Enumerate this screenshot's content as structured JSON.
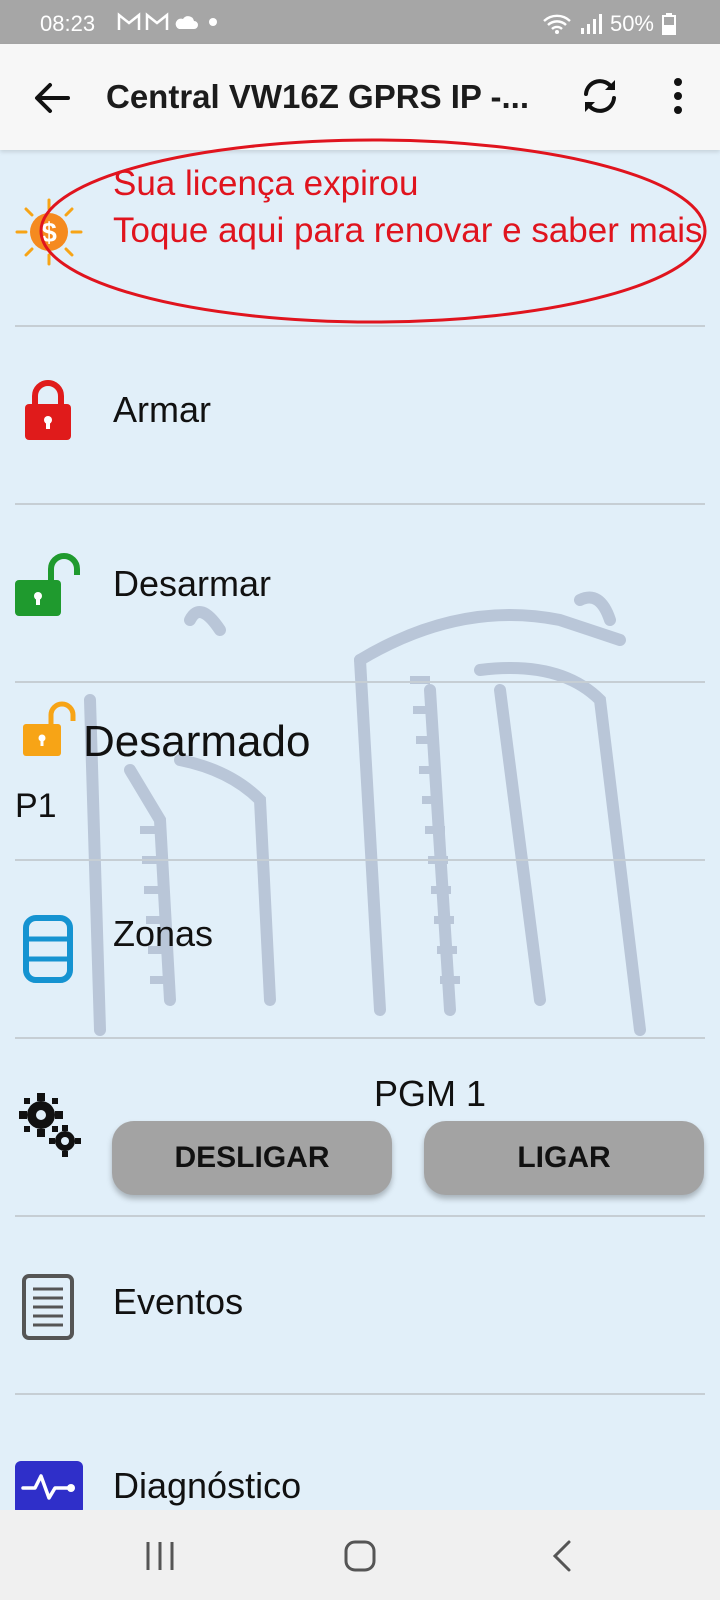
{
  "status_bar": {
    "time": "08:23",
    "battery": "50%"
  },
  "app_bar": {
    "title": "Central VW16Z GPRS IP -..."
  },
  "license": {
    "line1": "Sua licença expirou",
    "line2": "Toque aqui para renovar e saber mais",
    "color": "#e0141e"
  },
  "menu": {
    "armar": "Armar",
    "desarmar": "Desarmar",
    "state": "Desarmado",
    "partition": "P1",
    "zonas": "Zonas",
    "eventos": "Eventos",
    "diagnostico": "Diagnóstico"
  },
  "pgm": {
    "title": "PGM 1",
    "off_label": "DESLIGAR",
    "on_label": "LIGAR"
  },
  "icons": {
    "license": "dollar-sun-icon",
    "armar": "red-lock-icon",
    "desarmar": "green-unlock-icon",
    "state": "orange-unlock-icon",
    "zonas": "zones-cylinder-icon",
    "pgm": "gears-icon",
    "eventos": "document-icon",
    "diagnostico": "pulse-icon"
  },
  "colors": {
    "background": "#e1eff9",
    "lock_red": "#e01b1b",
    "unlock_green": "#1f9a2e",
    "unlock_orange": "#f7a416",
    "zonas_blue": "#1593d1",
    "diag_blue": "#2f2fc9"
  }
}
